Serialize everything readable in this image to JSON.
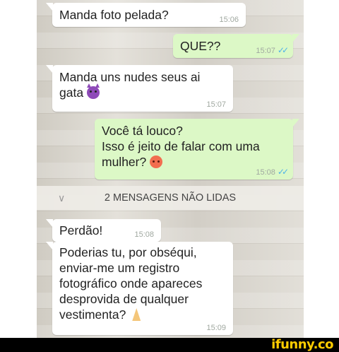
{
  "messages": [
    {
      "text": "Manda foto pelada?",
      "time": "15:06"
    },
    {
      "text": "QUE??",
      "time": "15:07",
      "ticks": "✓✓"
    },
    {
      "text": "Manda uns nudes seus ai\ngata",
      "time": "15:07",
      "emoji": "smiling-devil"
    },
    {
      "text": "Você tá louco?\nIsso é jeito de falar com uma\nmulher?",
      "time": "15:08",
      "ticks": "✓✓",
      "emoji": "angry-face"
    },
    {
      "text": "Perdão!",
      "time": "15:08"
    },
    {
      "text": "Poderias tu, por obséqui,\nenviar-me um registro\nfotográfico onde apareces\ndesprovida de qualquer\nvestimenta?",
      "time": "15:09",
      "emoji": "praying-hands"
    }
  ],
  "unread_banner": {
    "label": "2 MENSAGENS NÃO LIDAS",
    "icon": "chevron-down-icon"
  },
  "watermark": {
    "text": "ifunny.co"
  },
  "colors": {
    "incoming": "#ffffff",
    "outgoing": "#dcf8c6",
    "read_ticks": "#4fb3e8",
    "brand": "#ffcc00"
  }
}
